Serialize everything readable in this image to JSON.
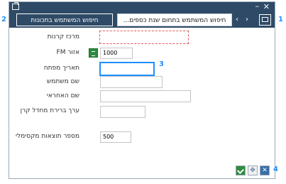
{
  "tabs": {
    "active_label": "...חיפוש המשתמש בתחום שנת כספים",
    "inactive_label": "חיפוש המשתמש בתכונות"
  },
  "nav": {
    "left_glyph": "‹",
    "right_glyph": "›"
  },
  "titlebar": {
    "minimize_glyph": "–",
    "close_glyph": "✕"
  },
  "form": {
    "cost_center_label": "מרכז קרנות",
    "area_label": "אזור FM",
    "area_value": "1000",
    "date_label": "תאריך מפתח",
    "username_label": "שם משתמש",
    "responsible_label": "שם האחראי",
    "fund_value_label": "ערך ברירת מחדל קרן",
    "max_results_label": "מספר תוצאות מקסימלי",
    "max_results_value": "500"
  },
  "actions": {
    "move_glyph": "✥",
    "close_glyph": "✕"
  },
  "callouts": {
    "c1": "1",
    "c2": "2",
    "c3": "3",
    "c4": "4"
  },
  "colors": {
    "frame": "#2e4a66",
    "accent": "#1e90ff",
    "ok": "#2e8b3e",
    "required_border": "#e05a5a"
  },
  "icons": [
    "folder-icon",
    "chevron-left-icon",
    "chevron-right-icon",
    "minimize-icon",
    "close-icon",
    "matchcode-icon",
    "check-icon",
    "move-icon"
  ]
}
